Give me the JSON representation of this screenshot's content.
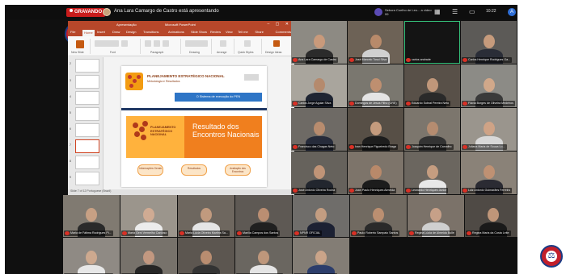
{
  "meeting": {
    "recording_label": "GRAVANDO",
    "presenting_text": "Ana Lara Camargo de Castro está apresentando",
    "phone_participant": "Sebora Coelho de Leo... a vídeo 99",
    "clock": "10:22",
    "user_initial": "A"
  },
  "ppt": {
    "file_title": "Apresentação",
    "app_title": "Microsoft PowerPoint",
    "tabs": [
      "File",
      "Home",
      "Insert",
      "Draw",
      "Design",
      "Transitions",
      "Animations",
      "Slide Show",
      "Review",
      "View",
      "Tell me"
    ],
    "active_tab_index": 1,
    "share_label": "Share",
    "comments_label": "Comments",
    "ribbon_groups": [
      "New Slide",
      "Font",
      "Paragraph",
      "Drawing",
      "Arrange",
      "Quick Styles",
      "Design Ideas"
    ],
    "slide_numbers": [
      "2",
      "3",
      "4",
      "5",
      "6",
      "7",
      "8",
      "9"
    ],
    "selected_slide_index": 5,
    "status_text": "Slide 7 of 12   Portuguese (Brazil)"
  },
  "slide": {
    "header_title": "PLANEJAMENTO ESTRATÉGICO NACIONAL",
    "header_sub": "Metodologia e Resultados",
    "button_label": "O Sistema de execução do PEN",
    "banner_left_title": "PLANEJAMENTO ESTRATÉGICO NACIONAL",
    "banner_right_title": "Resultado dos Encontros Nacionais",
    "pills": [
      "Informações Gerais",
      "Resultados",
      "Avaliação dos Encontros"
    ]
  },
  "participants": [
    {
      "name": "Ana Lara Camargo de Castro",
      "bg": "#8d8a83",
      "head": "#c99a7b",
      "body": "#2b2b2b"
    },
    {
      "name": "José Marcelo Tossi Silva",
      "bg": "#6d6256",
      "head": "#b88a6a",
      "body": "#d0d0d0"
    },
    {
      "name": "carlos andrade",
      "bg": "#141414",
      "head": "",
      "body": "",
      "dark": true
    },
    {
      "name": "Carlos Henrique Rodrigues Ga...",
      "bg": "#5c5a57",
      "head": "#c69b7c",
      "body": "#2a2d37"
    },
    {
      "name": "Carlos Jorge Aguiar Silva",
      "bg": "#a9a59d",
      "head": "#b58a6d",
      "body": "#1f2533"
    },
    {
      "name": "Domingos de Jesus Filho (GRE)",
      "bg": "#7a776f",
      "head": "#be8f70",
      "body": "#e4e4e4"
    },
    {
      "name": "Eduardo Sobral Pereira Neto",
      "bg": "#585048",
      "head": "#c0977a",
      "body": "#2a2a2a"
    },
    {
      "name": "Flávia Borges de Oliveira Medeiros",
      "bg": "#8c8b86",
      "head": "#d1a88a",
      "body": "#3a3a3a"
    },
    {
      "name": "Francisco das Chagas Neto",
      "bg": "#6e6a65",
      "head": "#b88c6e",
      "body": "#262b3a"
    },
    {
      "name": "Ivan Henrique Figueiredo Braga",
      "bg": "#574f46",
      "head": "#c49b7d",
      "body": "#1d1d1d"
    },
    {
      "name": "Joaquim Henrique de Carvalho",
      "bg": "#7c766d",
      "head": "#b58c70",
      "body": "#333333"
    },
    {
      "name": "Juliana Maria de Souza Lo...",
      "bg": "#9a958d",
      "head": "#cfa386",
      "body": "#d8d8d8"
    },
    {
      "name": "José Antonio Oliveira Rocha",
      "bg": "#66625c",
      "head": "#c09477",
      "body": "#22262e"
    },
    {
      "name": "Juan Paulo Henriques Almeida",
      "bg": "#7d746a",
      "head": "#b8896a",
      "body": "#1c1c1c"
    },
    {
      "name": "Leonardo Henriques Junior",
      "bg": "#6b665f",
      "head": "#c59d80",
      "body": "#e8e8e8"
    },
    {
      "name": "Luiz Antonio Guimarães Ferreira",
      "bg": "#8a8278",
      "head": "#bf9173",
      "body": "#2b2b33"
    },
    {
      "name": "Maria de Fátima Rodrigues Pi...",
      "bg": "#807a71",
      "head": "#c7a084",
      "body": "#2a2a2a"
    },
    {
      "name": "Maria Geni Vermelho Cardoso",
      "bg": "#9b958c",
      "head": "#d0ab93",
      "body": "#ececec"
    },
    {
      "name": "Maria Lúcia Oliveira Martins Sa...",
      "bg": "#6e675f",
      "head": "#c19a7e",
      "body": "#e5e5e5"
    },
    {
      "name": "Marília Campos dos Santos",
      "bg": "#5e5954",
      "head": "#ba8e72",
      "body": "#202020"
    },
    {
      "name": "NPNR OFICIAL",
      "bg": "#6f6d6a",
      "head": "#c39d81",
      "body": "#1c2133"
    },
    {
      "name": "Paulo Roberto Sampaio Santos",
      "bg": "#716a61",
      "head": "#bb8f71",
      "body": "#2a2a2a"
    },
    {
      "name": "Regina Lúcia de Almeida Bulle",
      "bg": "#7b7269",
      "head": "#c6a088",
      "body": "#cfcfcf"
    },
    {
      "name": "Regina Maria da Costa Leite",
      "bg": "#4f4a45",
      "head": "#bf9679",
      "body": "#1a1a1a"
    },
    {
      "name": "Rogério de Castro Rosa Aquino",
      "bg": "#8f8a84",
      "head": "#cda98f",
      "body": "#e7e7e7"
    },
    {
      "name": "Samara Viana Teixeira",
      "bg": "#77726b",
      "head": "#c29880",
      "body": "#252525"
    },
    {
      "name": "Sebastião Pereira Neto",
      "bg": "#5c5650",
      "head": "#b98d70",
      "body": "#333333"
    },
    {
      "name": "Silvio Luiz de Jesus Guerreiro",
      "bg": "#6a6660",
      "head": "#be977b",
      "body": "#e4e4e4"
    },
    {
      "name": "Tiemie Maria Pacheco de...",
      "bg": "#837d75",
      "head": "#caa489",
      "body": "#2c3d6b"
    }
  ]
}
